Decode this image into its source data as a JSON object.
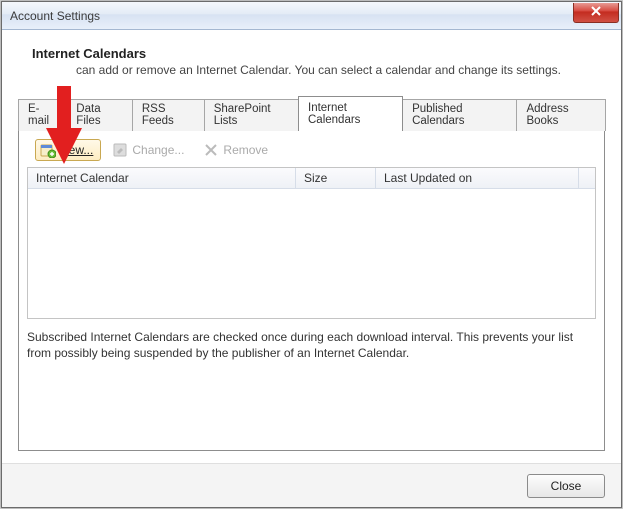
{
  "window": {
    "title": "Account Settings"
  },
  "header": {
    "title": "Internet Calendars",
    "description": "can add or remove an Internet Calendar. You can select a calendar and change its settings."
  },
  "tabs": [
    {
      "label": "E-mail"
    },
    {
      "label": "Data Files"
    },
    {
      "label": "RSS Feeds"
    },
    {
      "label": "SharePoint Lists"
    },
    {
      "label": "Internet Calendars"
    },
    {
      "label": "Published Calendars"
    },
    {
      "label": "Address Books"
    }
  ],
  "active_tab_index": 4,
  "toolbar": {
    "new_label": "New...",
    "change_label": "Change...",
    "remove_label": "Remove"
  },
  "columns": {
    "c1": "Internet Calendar",
    "c2": "Size",
    "c3": "Last Updated on"
  },
  "rows": [],
  "footnote": "Subscribed Internet Calendars are checked once during each download interval. This prevents your list from possibly being suspended by the publisher of an Internet Calendar.",
  "buttons": {
    "close": "Close"
  },
  "annotation": {
    "arrow_color": "#e21f1f"
  }
}
